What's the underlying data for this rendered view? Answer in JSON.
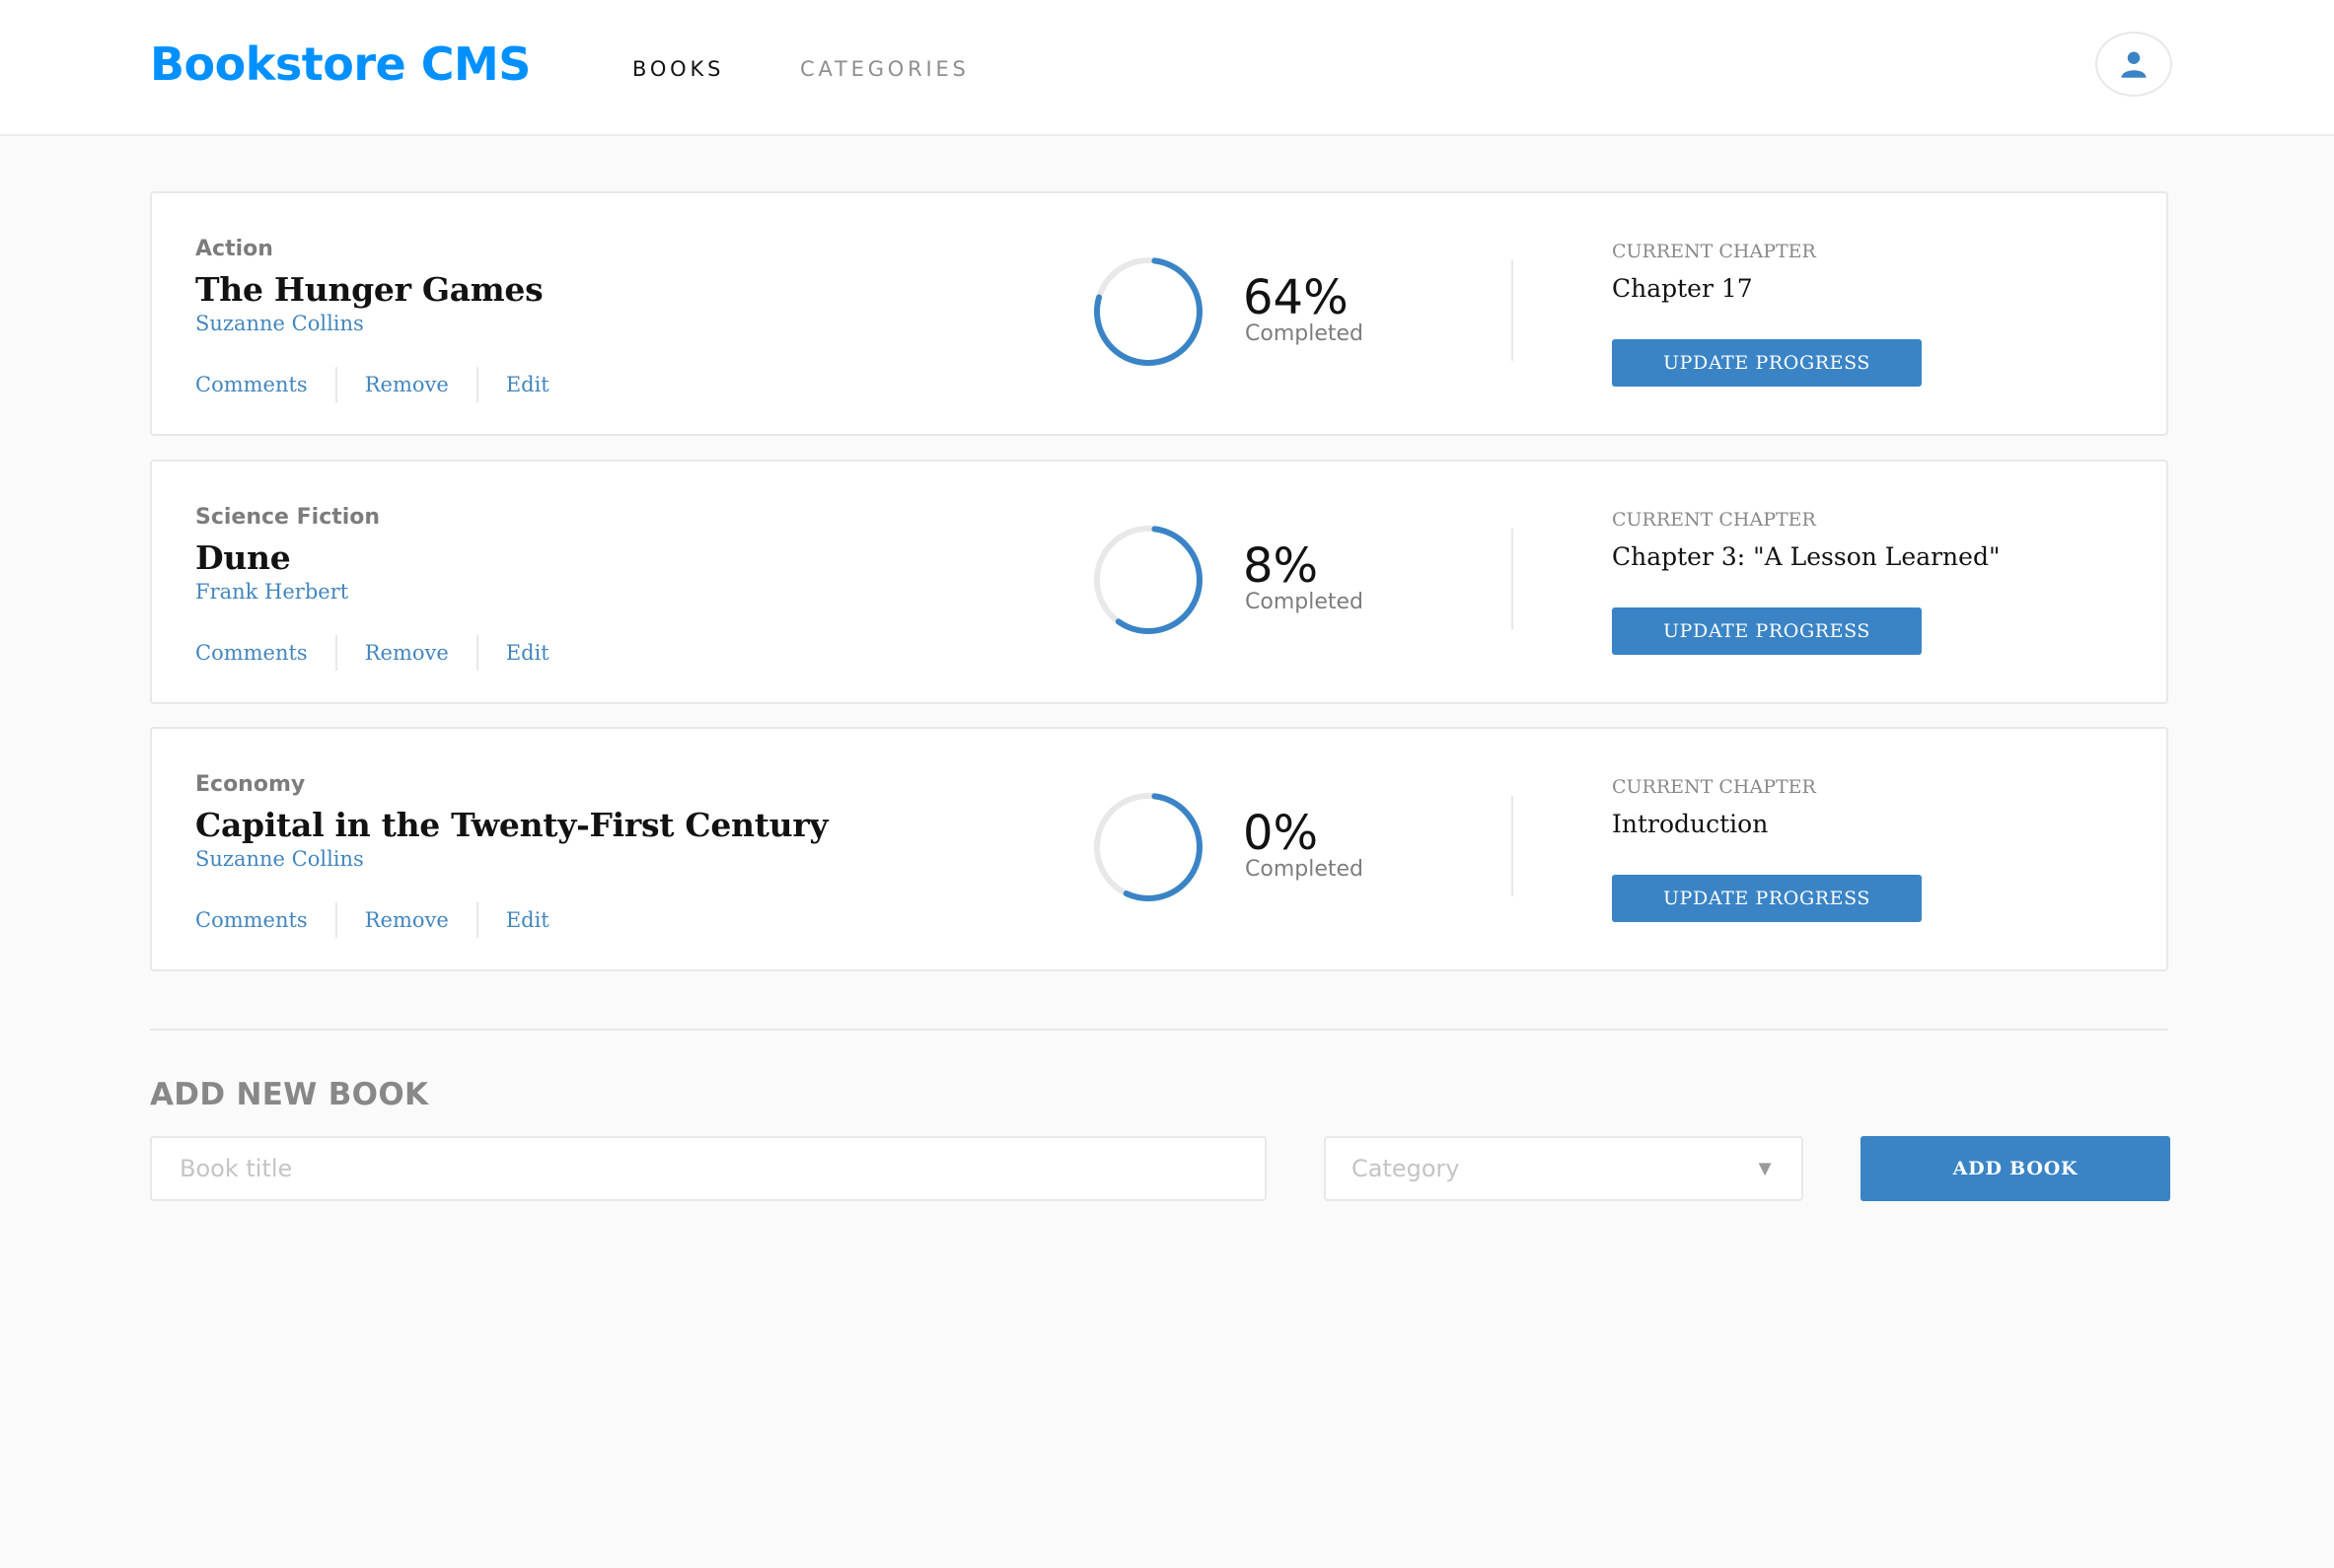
{
  "colors": {
    "brand": "#0290ff",
    "accent": "#3a84c6",
    "link": "#4386bf",
    "ring_track": "#e8e8e8",
    "ring_progress": "#3a84c6"
  },
  "header": {
    "logo": "Bookstore CMS",
    "nav": [
      {
        "label": "BOOKS",
        "active": true
      },
      {
        "label": "CATEGORIES",
        "active": false
      }
    ],
    "user_icon": "user-icon"
  },
  "books": [
    {
      "category": "Action",
      "title": "The Hunger Games",
      "author": "Suzanne Collins",
      "actions": [
        "Comments",
        "Remove",
        "Edit"
      ],
      "progress": 64,
      "percent_label": "64%",
      "completed_label": "Completed",
      "chapter_label": "Current Chapter",
      "chapter": "Chapter 17",
      "update_label": "UPDATE PROGRESS"
    },
    {
      "category": "Science Fiction",
      "title": "Dune",
      "author": "Frank Herbert",
      "actions": [
        "Comments",
        "Remove",
        "Edit"
      ],
      "progress": 8,
      "percent_label": "8%",
      "completed_label": "Completed",
      "chapter_label": "Current Chapter",
      "chapter": "Chapter 3: \"A Lesson Learned\"",
      "update_label": "UPDATE PROGRESS"
    },
    {
      "category": "Economy",
      "title": "Capital in the Twenty-First Century",
      "author": "Suzanne Collins",
      "actions": [
        "Comments",
        "Remove",
        "Edit"
      ],
      "progress": 0,
      "percent_label": "0%",
      "completed_label": "Completed",
      "chapter_label": "Current Chapter",
      "chapter": "Introduction",
      "update_label": "UPDATE PROGRESS"
    }
  ],
  "form": {
    "title": "ADD NEW BOOK",
    "title_placeholder": "Book title",
    "title_value": "",
    "category_placeholder": "Category",
    "caret_icon": "chevron-down-icon",
    "submit_label": "ADD BOOK"
  }
}
